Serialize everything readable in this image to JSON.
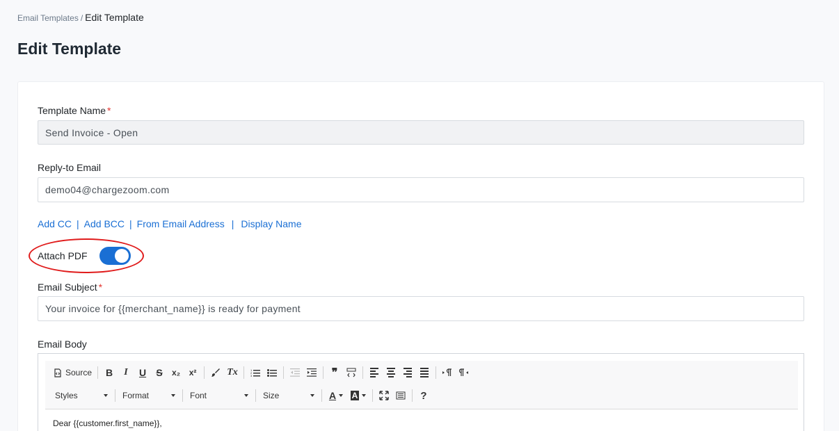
{
  "breadcrumb": {
    "parent": "Email Templates",
    "separator": "/",
    "current": "Edit Template"
  },
  "page": {
    "title": "Edit Template"
  },
  "form": {
    "template_name": {
      "label": "Template Name",
      "required_mark": "*",
      "value": "Send Invoice - Open"
    },
    "reply_to": {
      "label": "Reply-to Email",
      "value": "demo04@chargezoom.com"
    },
    "links": {
      "add_cc": "Add CC",
      "add_bcc": "Add BCC",
      "from_email": "From Email Address",
      "display_name": "Display Name",
      "pipe": "|"
    },
    "attach_pdf": {
      "label": "Attach PDF",
      "enabled": true
    },
    "subject": {
      "label": "Email Subject",
      "required_mark": "*",
      "value": "Your invoice for {{merchant_name}} is ready for payment"
    },
    "body": {
      "label": "Email Body",
      "first_line": "Dear {{customer.first_name}},"
    }
  },
  "editor": {
    "source_label": "Source",
    "combos": {
      "styles": "Styles",
      "format": "Format",
      "font": "Font",
      "size": "Size"
    },
    "glyphs": {
      "bold": "B",
      "italic": "I",
      "underline": "U",
      "strike": "S",
      "subscript": "x₂",
      "superscript": "x²",
      "remove_format": "Tx",
      "blockquote": "❞",
      "help": "?",
      "text_color": "A",
      "bg_color": "A"
    }
  },
  "colors": {
    "accent": "#1a6fd4",
    "required": "#e3342f",
    "highlight": "#e01b1b"
  }
}
